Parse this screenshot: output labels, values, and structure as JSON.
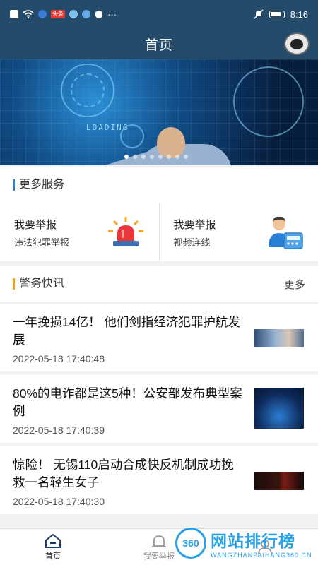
{
  "status_bar": {
    "time": "8:16",
    "badge_text": "头条",
    "more": "···"
  },
  "header": {
    "title": "首页"
  },
  "banner": {
    "loading_text": "LOADING",
    "total_slides": 8,
    "active_slide": 0
  },
  "services": {
    "heading": "更多服务",
    "items": [
      {
        "title": "我要举报",
        "subtitle": "违法犯罪举报",
        "icon": "alarm-siren-icon"
      },
      {
        "title": "我要举报",
        "subtitle": "视频连线",
        "icon": "video-call-operator-icon"
      }
    ]
  },
  "news": {
    "heading": "警务快讯",
    "more_label": "更多",
    "items": [
      {
        "title": "一年挽损14亿！ 他们剑指经济犯罪护航发展",
        "date": "2022-05-18 17:40:48"
      },
      {
        "title": "80%的电诈都是这5种！公安部发布典型案例",
        "date": "2022-05-18 17:40:39"
      },
      {
        "title": "惊险！ 无锡110启动合成快反机制成功挽救一名轻生女子",
        "date": "2022-05-18 17:40:30"
      }
    ]
  },
  "bottom_nav": {
    "items": [
      {
        "label": "首页",
        "icon": "home-icon"
      },
      {
        "label": "我要举报",
        "icon": "alarm-icon"
      },
      {
        "label": "",
        "icon": "user-icon"
      }
    ]
  },
  "watermark": {
    "badge": "360",
    "main": "网站排行榜",
    "sub": "WANGZHANPAIHANG360.CN"
  },
  "colors": {
    "header_bg": "#254b6b",
    "accent_blue": "#3b7fc4",
    "accent_orange": "#f0a21b",
    "watermark": "#2aa0e6"
  }
}
